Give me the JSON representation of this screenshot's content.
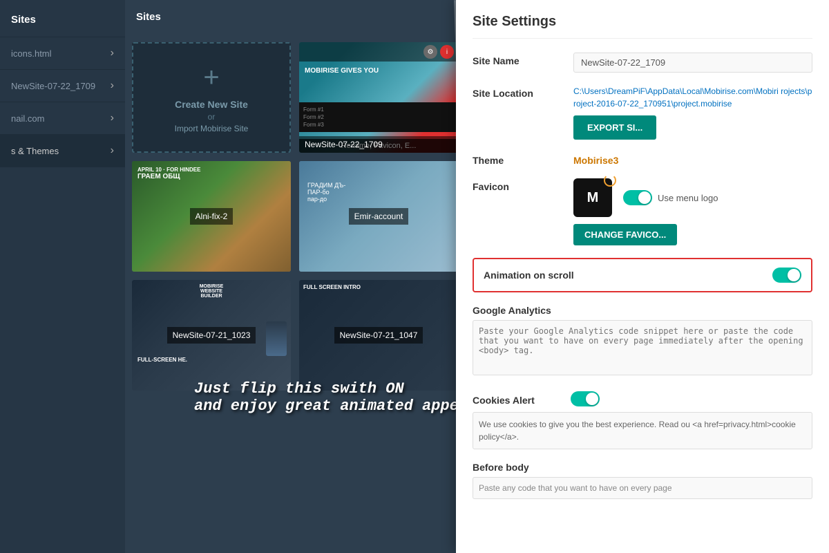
{
  "sidebar": {
    "header": "Sites",
    "items": [
      {
        "id": "icons",
        "label": "icons.html",
        "hasChevron": true
      },
      {
        "id": "newsite",
        "label": "NewSite-07-22_1709",
        "hasChevron": true
      },
      {
        "id": "email",
        "label": "nail.com",
        "hasChevron": true
      },
      {
        "id": "themes",
        "label": "s & Themes",
        "hasChevron": true
      }
    ]
  },
  "main": {
    "header": "Sites",
    "cards": [
      {
        "id": "new-site",
        "type": "new",
        "label": "Create New Site",
        "sublabel": "or",
        "sublabel2": "Import Mobirise Site"
      },
      {
        "id": "newsite-0722",
        "type": "thumb",
        "bg": "newsite",
        "label": "NewSite-07-22_1709",
        "hasOverlay": true,
        "overlayText": "Rename, Favicon, E..."
      },
      {
        "id": "alni-fix-2",
        "type": "thumb",
        "bg": "alni",
        "label": "Alni-fix-2"
      },
      {
        "id": "emir-account",
        "type": "thumb",
        "bg": "emir",
        "label": "Emir-account"
      },
      {
        "id": "newsite-0721-1023",
        "type": "thumb",
        "bg": "new1023",
        "label": "NewSite-07-21_1023"
      },
      {
        "id": "newsite-0721-1047",
        "type": "thumb",
        "bg": "new1047",
        "label": "NewSite-07-21_1047"
      }
    ]
  },
  "annotation": {
    "line1": "Just flip this swith ON",
    "line2": "and enjoy great animated appearance!"
  },
  "settings": {
    "title": "Site Settings",
    "site_name_label": "Site Name",
    "site_name_value": "NewSite-07-22_1709",
    "site_location_label": "Site Location",
    "site_location_value": "C:\\Users\\DreamPiF\\AppData\\Local\\Mobirise.com\\Mobiri rojects\\project-2016-07-22_170951\\project.mobirise",
    "export_btn_label": "EXPORT SI...",
    "theme_label": "Theme",
    "theme_value": "Mobirise3",
    "favicon_label": "Favicon",
    "use_logo_label": "Use menu logo",
    "change_favicon_btn": "CHANGE FAVICO...",
    "animation_label": "Animation on scroll",
    "animation_on": true,
    "google_analytics_label": "Google Analytics",
    "google_analytics_placeholder": "Paste your Google Analytics code snippet here or paste the code that you want to have on every page immediately after the opening <body> tag.",
    "cookies_label": "Cookies Alert",
    "cookies_on": true,
    "cookies_text": "We use cookies to give you the best experience. Read ou <a href=privacy.html>cookie policy</a>.",
    "before_body_label": "Before body",
    "before_body_hint": "Paste any code that you want to have on every page"
  }
}
